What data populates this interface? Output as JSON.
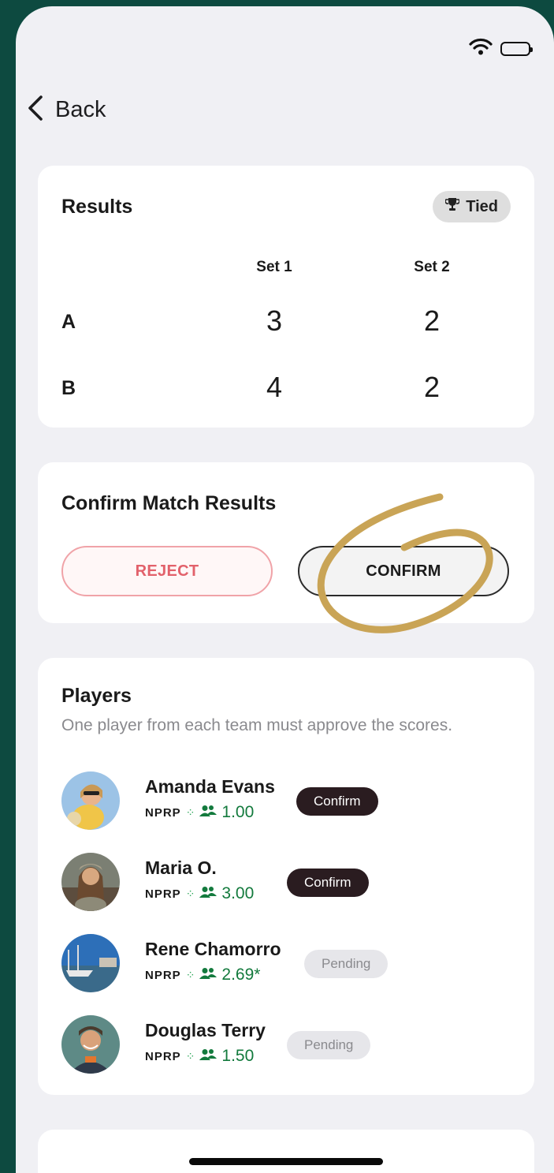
{
  "nav": {
    "back_label": "Back"
  },
  "results": {
    "title": "Results",
    "badge": "Tied",
    "sets": [
      "Set 1",
      "Set 2"
    ],
    "teams": [
      {
        "label": "A",
        "scores": [
          "3",
          "2"
        ]
      },
      {
        "label": "B",
        "scores": [
          "4",
          "2"
        ]
      }
    ]
  },
  "confirm_section": {
    "title": "Confirm Match Results",
    "reject_label": "REJECT",
    "confirm_label": "CONFIRM"
  },
  "players": {
    "title": "Players",
    "subtitle": "One player from each team must approve the scores.",
    "rating_system": "NPRP",
    "list": [
      {
        "name": "Amanda Evans",
        "rating": "1.00",
        "status": "Confirm"
      },
      {
        "name": "Maria O.",
        "rating": "3.00",
        "status": "Confirm"
      },
      {
        "name": "Rene Chamorro",
        "rating": "2.69*",
        "status": "Pending"
      },
      {
        "name": "Douglas Terry",
        "rating": "1.50",
        "status": "Pending"
      }
    ]
  },
  "colors": {
    "background": "#0d4a40",
    "reject": "#e2616b",
    "rating_green": "#137a3d",
    "confirm_badge": "#2a1c20",
    "annotation": "#c9a456"
  }
}
